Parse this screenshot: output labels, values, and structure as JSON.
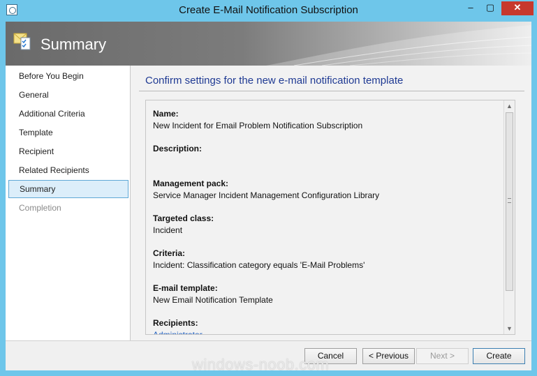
{
  "window": {
    "title": "Create E-Mail Notification Subscription",
    "controls": {
      "minimize": "‒",
      "maximize": "▢",
      "close": "✕"
    }
  },
  "banner": {
    "title": "Summary"
  },
  "sidebar": {
    "items": [
      {
        "label": "Before You Begin",
        "state": "normal"
      },
      {
        "label": "General",
        "state": "normal"
      },
      {
        "label": "Additional Criteria",
        "state": "normal"
      },
      {
        "label": "Template",
        "state": "normal"
      },
      {
        "label": "Recipient",
        "state": "normal"
      },
      {
        "label": "Related Recipients",
        "state": "normal"
      },
      {
        "label": "Summary",
        "state": "selected"
      },
      {
        "label": "Completion",
        "state": "disabled"
      }
    ]
  },
  "main": {
    "heading": "Confirm settings for the new e-mail notification template",
    "fields": [
      {
        "label": "Name:",
        "value": "New Incident for Email Problem Notification Subscription"
      },
      {
        "label": "Description:",
        "value": ""
      },
      {
        "label": "Management pack:",
        "value": "Service Manager Incident Management Configuration Library"
      },
      {
        "label": "Targeted class:",
        "value": "Incident"
      },
      {
        "label": "Criteria:",
        "value": "Incident: Classification category equals 'E-Mail Problems'"
      },
      {
        "label": "E-mail template:",
        "value": "New Email Notification Template"
      },
      {
        "label": "Recipients:",
        "value": "Administrator"
      }
    ]
  },
  "footer": {
    "cancel_label": "Cancel",
    "previous_label": "< Previous",
    "next_label": "Next >",
    "create_label": "Create"
  },
  "watermark": "windows-noob.com"
}
